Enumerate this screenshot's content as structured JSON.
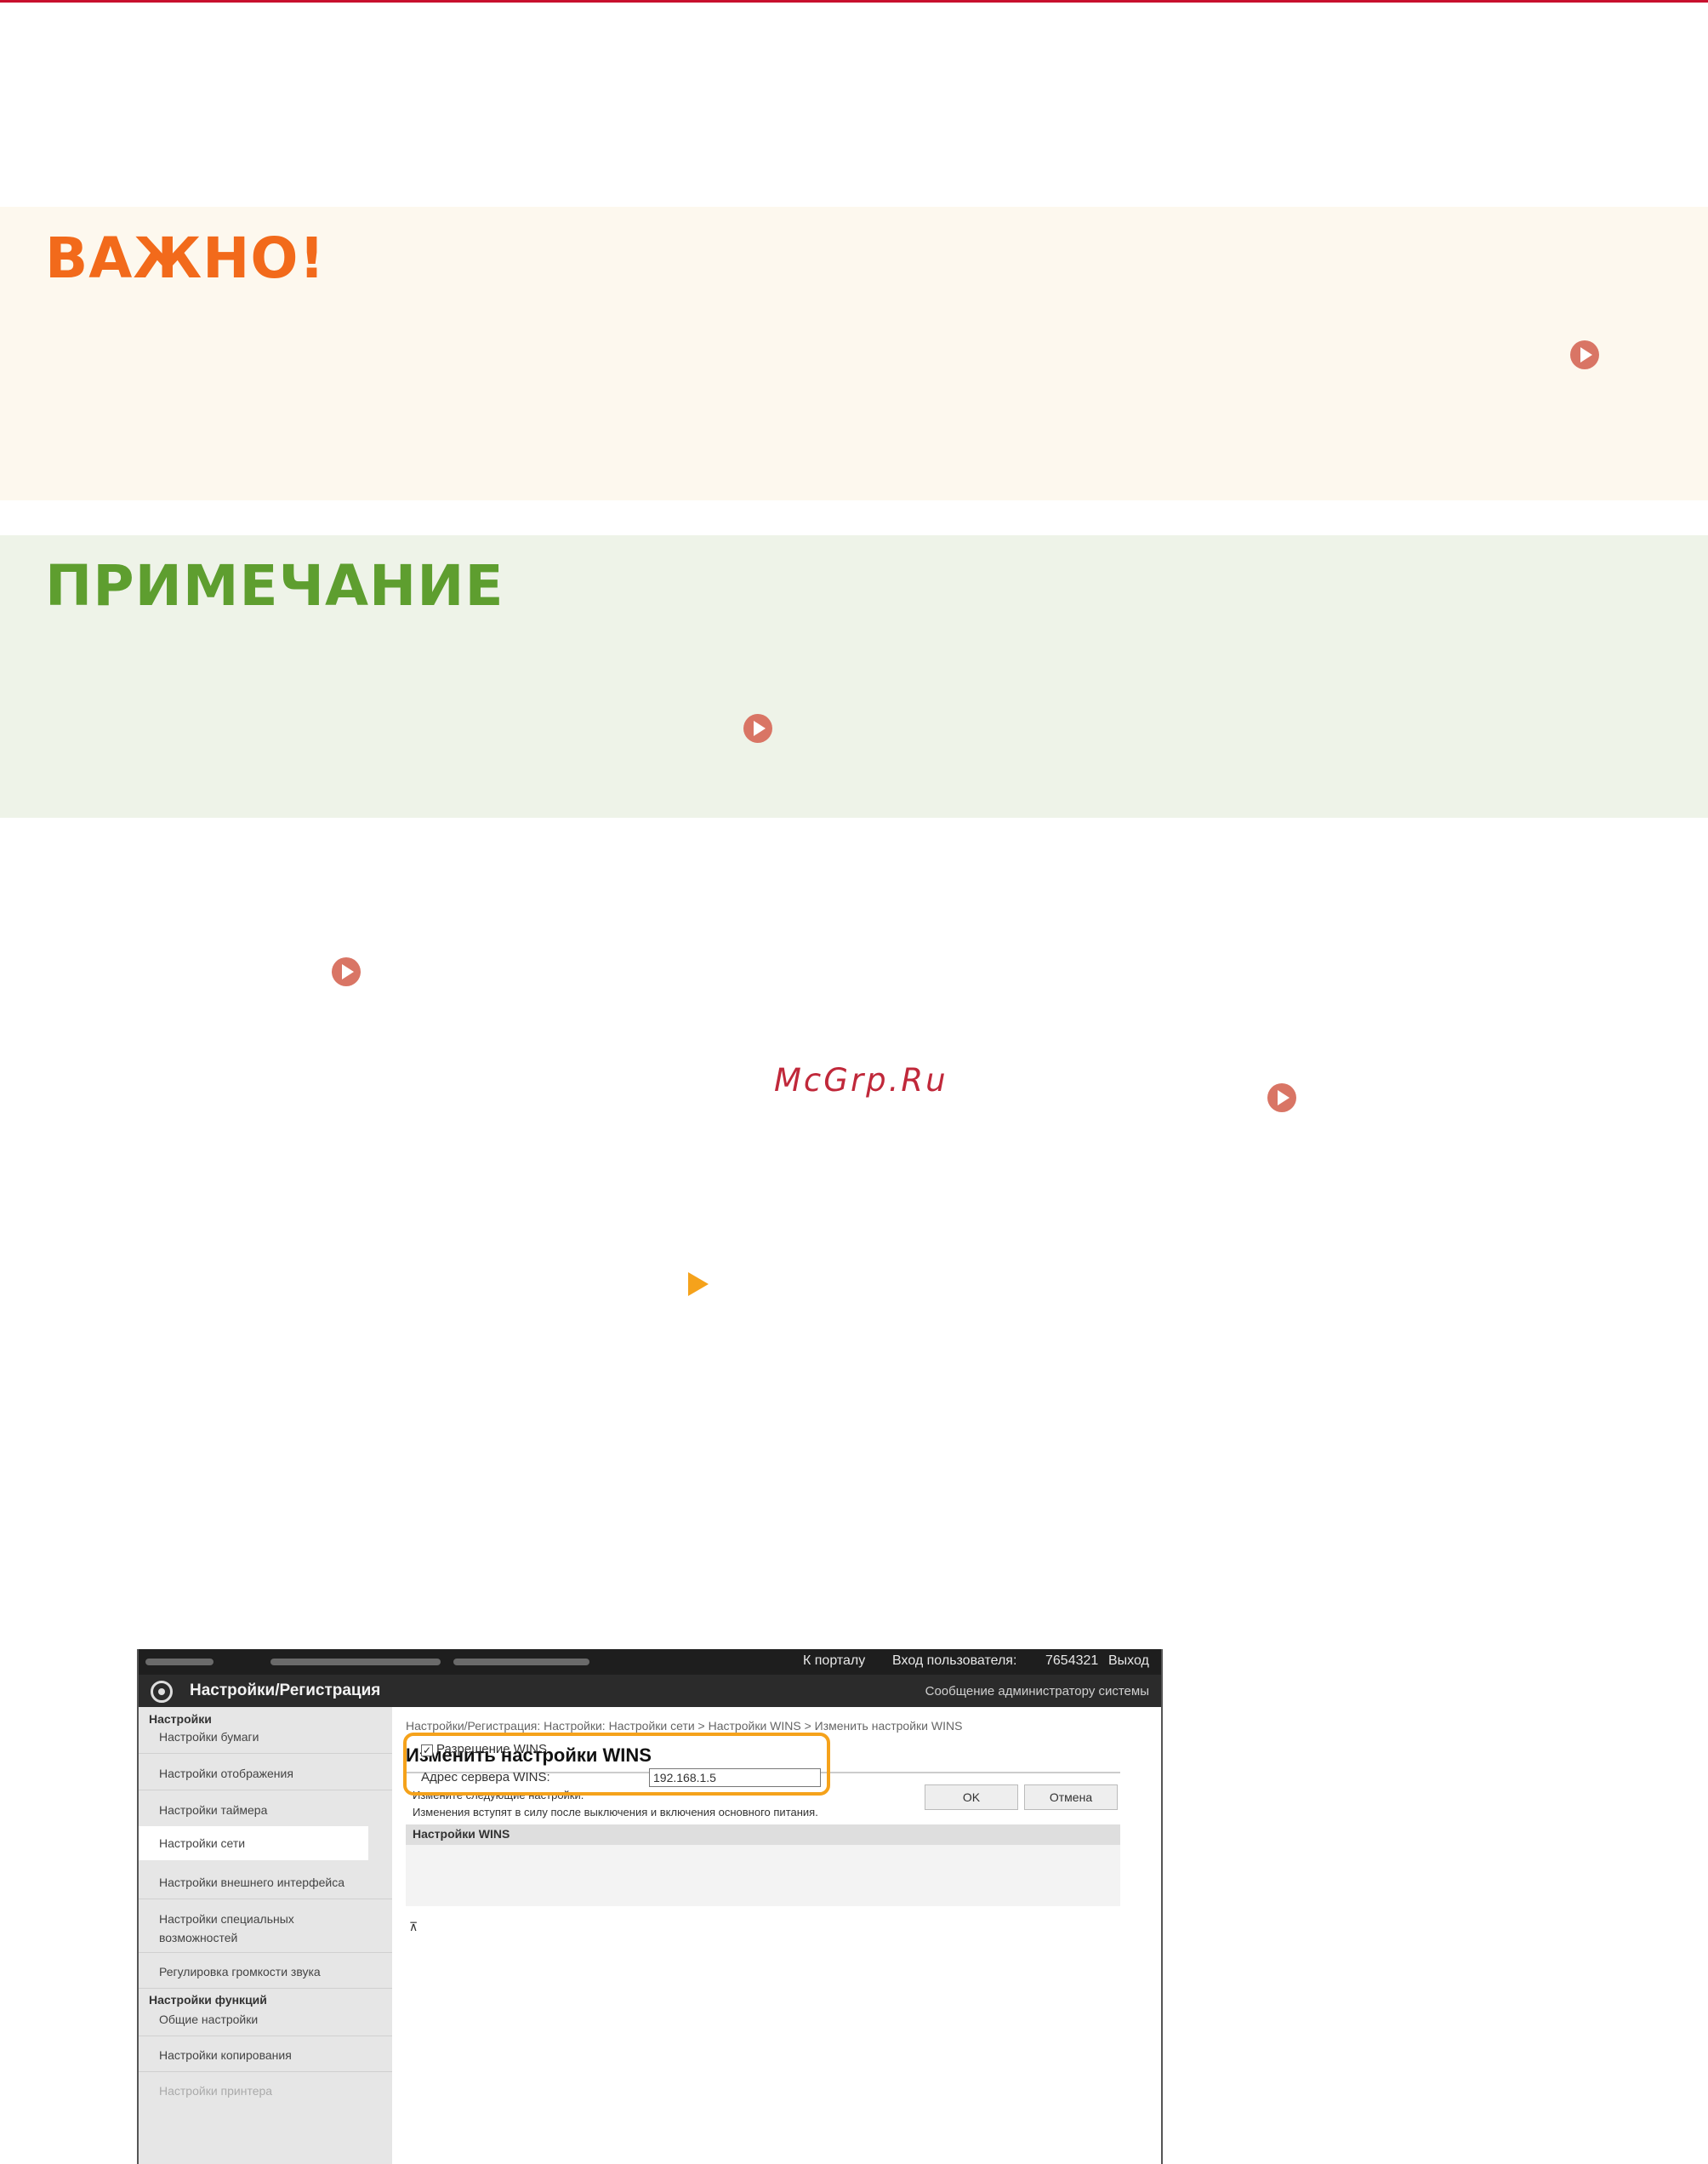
{
  "document": {
    "important_title": "ВАЖНО!",
    "note_title": "ПРИМЕЧАНИЕ",
    "watermark": "McGrp.Ru"
  },
  "icons": {
    "link_icon": "circle-play-icon",
    "step_arrow": "triangle-right-icon",
    "link_color": "#d97565",
    "arrow_color": "#f5a21b",
    "important_color": "#f26a1b",
    "note_color": "#5e9e2f"
  },
  "screenshot": {
    "topbar": {
      "portal_link": "К порталу",
      "login_label": "Вход пользователя:",
      "user_id": "7654321",
      "logout": "Выход"
    },
    "header": {
      "title": "Настройки/Регистрация",
      "admin_message": "Сообщение администратору системы"
    },
    "sidebar": {
      "settings_head": "Настройки",
      "items": [
        "Настройки бумаги",
        "Настройки отображения",
        "Настройки таймера",
        "Настройки сети",
        "Настройки внешнего интерфейса",
        "Настройки специальных возможностей",
        "Регулировка громкости звука"
      ],
      "function_head": "Настройки функций",
      "function_items": [
        "Общие настройки",
        "Настройки копирования",
        "Настройки принтера"
      ]
    },
    "main": {
      "breadcrumb": "Настройки/Регистрация: Настройки: Настройки сети > Настройки WINS > Изменить настройки WINS",
      "title": "Изменить настройки WINS",
      "description_1": "Измените следующие настройки.",
      "description_2": "Изменения вступят в силу после выключения и включения основного питания.",
      "ok_button": "OK",
      "cancel_button": "Отмена",
      "section_title": "Настройки WINS",
      "wins_checkbox_label": "Разрешение WINS",
      "wins_checked": true,
      "server_label": "Адрес сервера WINS:",
      "server_value": "192.168.1.5",
      "to_top": "⊼"
    }
  }
}
